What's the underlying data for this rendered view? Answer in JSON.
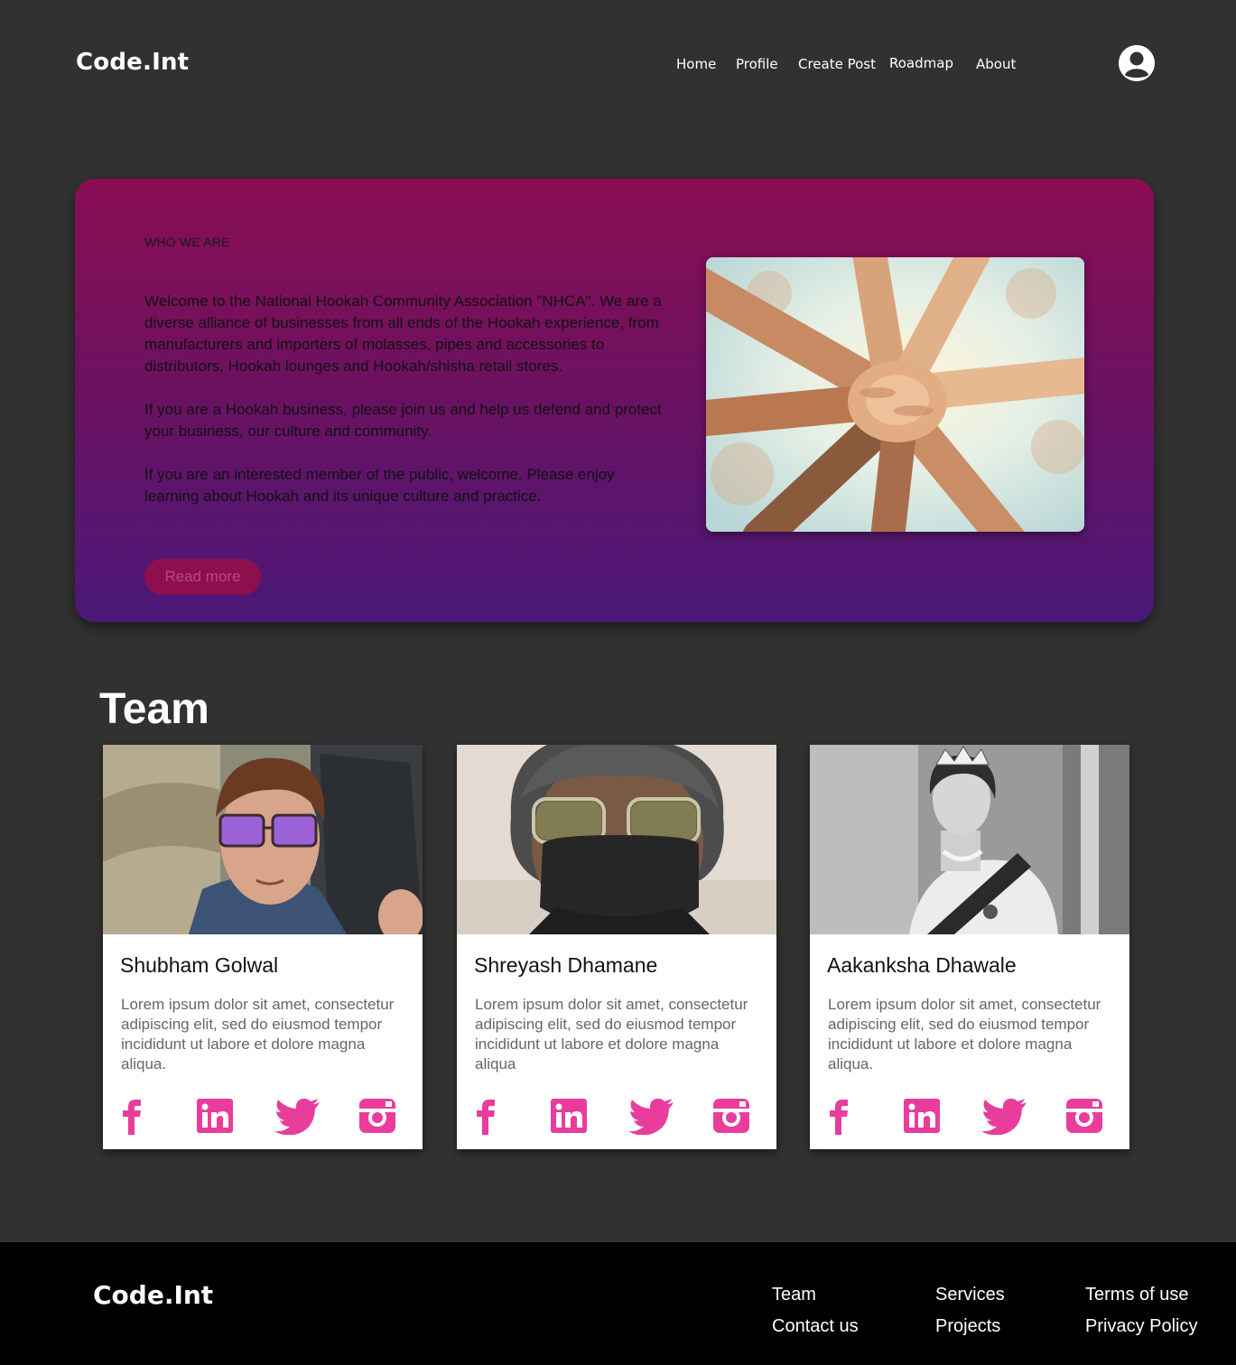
{
  "nav": {
    "brand": "Code.Int",
    "links": [
      "Home",
      "Profile",
      "Create Post",
      "Roadmap",
      "About"
    ]
  },
  "hero": {
    "eyebrow": "WHO WE ARE",
    "paragraphs": [
      "Welcome to the National Hookah Community Association \"NHCA\". We are a diverse alliance of businesses from all ends of the Hookah experience, from manufacturers and importers of molasses, pipes and accessories to distributors, Hookah lounges and Hookah/shisha retail stores.",
      "If you are a Hookah business, please join us and help us defend and protect your business, our culture and community.",
      "If you are an interested member of the public, welcome. Please enjoy learning about Hookah and its unique culture and practice."
    ],
    "button": "Read more"
  },
  "team": {
    "title": "Team",
    "members": [
      {
        "name": "Shubham Golwal",
        "desc": "Lorem ipsum dolor sit amet, consectetur adipiscing elit, sed do eiusmod tempor incididunt ut labore et dolore magna aliqua."
      },
      {
        "name": "Shreyash Dhamane",
        "desc": "Lorem ipsum dolor sit amet, consectetur adipiscing elit, sed do eiusmod tempor incididunt ut labore et dolore magna aliqua"
      },
      {
        "name": "Aakanksha Dhawale",
        "desc": "Lorem ipsum dolor sit amet, consectetur adipiscing elit, sed do eiusmod tempor incididunt ut labore et dolore magna aliqua."
      }
    ],
    "social_icons": [
      "facebook-icon",
      "linkedin-icon",
      "twitter-icon",
      "instagram-icon"
    ]
  },
  "footer": {
    "brand": "Code.Int",
    "links": [
      "Team",
      "Contact us",
      "Services",
      "Projects",
      "Terms of use",
      "Privacy Policy"
    ]
  },
  "colors": {
    "background": "#313131",
    "hero_top": "#8a0e52",
    "hero_bottom": "#4a1878",
    "accent_pink": "#e83d9c",
    "footer": "#000000"
  }
}
